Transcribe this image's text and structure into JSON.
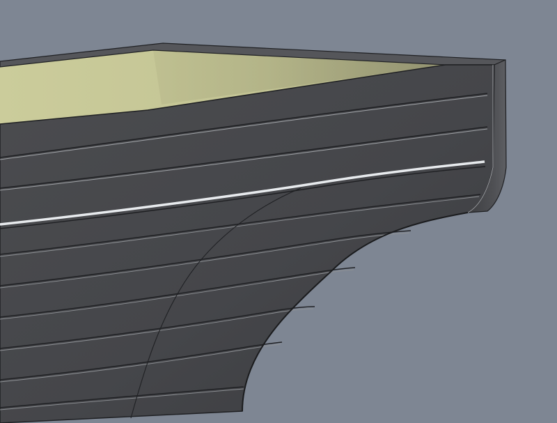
{
  "viewport": {
    "background": "#7e8693",
    "hull_color": "#4a4b4e",
    "hull_edge_color": "#1f2023",
    "interior_color": "#c8c99a",
    "plank_highlight": "#9fa2a6",
    "sheer_highlight": "#e8ebee"
  }
}
